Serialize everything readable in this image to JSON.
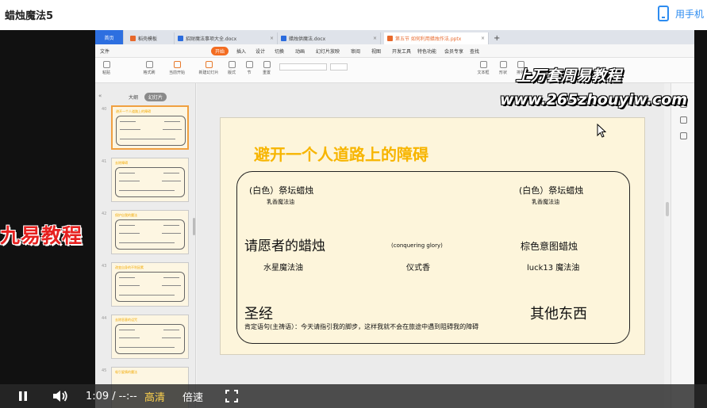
{
  "page": {
    "title": "蜡烛魔法5",
    "mobile_label": "用手机"
  },
  "wps": {
    "home_tab": "首页",
    "tabs": [
      {
        "label": "稻壳模板",
        "x": 0
      },
      {
        "label": "招财魔法事项大全.docx"
      },
      {
        "label": "蜡烛供魔法.docx"
      },
      {
        "label": "第五节 如何利用蜡烛作法.pptx"
      }
    ],
    "menu": [
      "文件",
      "开始",
      "插入",
      "设计",
      "切换",
      "动画",
      "幻灯片放映",
      "审阅",
      "视图",
      "开发工具",
      "特色功能",
      "会员专享",
      "查找"
    ],
    "toolbar": [
      "粘贴",
      "格式刷",
      "当前开始",
      "新建幻灯片",
      "版式",
      "节",
      "重置",
      "文本框",
      "形状",
      "排列"
    ]
  },
  "panel": {
    "outline_label": "大纲",
    "slides_label": "幻灯片",
    "thumbnails": [
      {
        "num": "40",
        "title": "避开一个人道路上的障碍",
        "active": true
      },
      {
        "num": "41",
        "title": "去除障碍",
        "active": false
      },
      {
        "num": "42",
        "title": "保护自我的魔法",
        "active": false
      },
      {
        "num": "43",
        "title": "改变自身的不利因素",
        "active": false
      },
      {
        "num": "44",
        "title": "去除恶意的诅咒",
        "active": false
      },
      {
        "num": "45",
        "title": "吸引爱情的魔法",
        "active": false
      }
    ]
  },
  "slide": {
    "title": "避开一个人道路上的障碍",
    "left_top_label": "(白色）祭坛蜡烛",
    "left_top_sub": "乳香魔法油",
    "right_top_label": "(白色）祭坛蜡烛",
    "right_top_sub": "乳香魔法油",
    "petitioner": "请愿者的蜡烛",
    "conquering": "(conquering glory)",
    "brown": "棕色意图蜡烛",
    "mercury_oil": "水星魔法油",
    "incense": "仪式香",
    "luck_oil": "luck13 魔法油",
    "bible": "圣经",
    "others": "其他东西",
    "affirmation": "肯定语句(主祷语）：今天请指引我的脚步，这样我就不会在旅途中遇到阻碍我的障碍"
  },
  "watermark": {
    "line1": "上万套周易教程",
    "line2": "www.265zhouyiw.com",
    "brand": "九易教程"
  },
  "player": {
    "time": "1:09",
    "separator": "/",
    "duration": "--:--",
    "quality": "高清",
    "speed": "倍速"
  }
}
